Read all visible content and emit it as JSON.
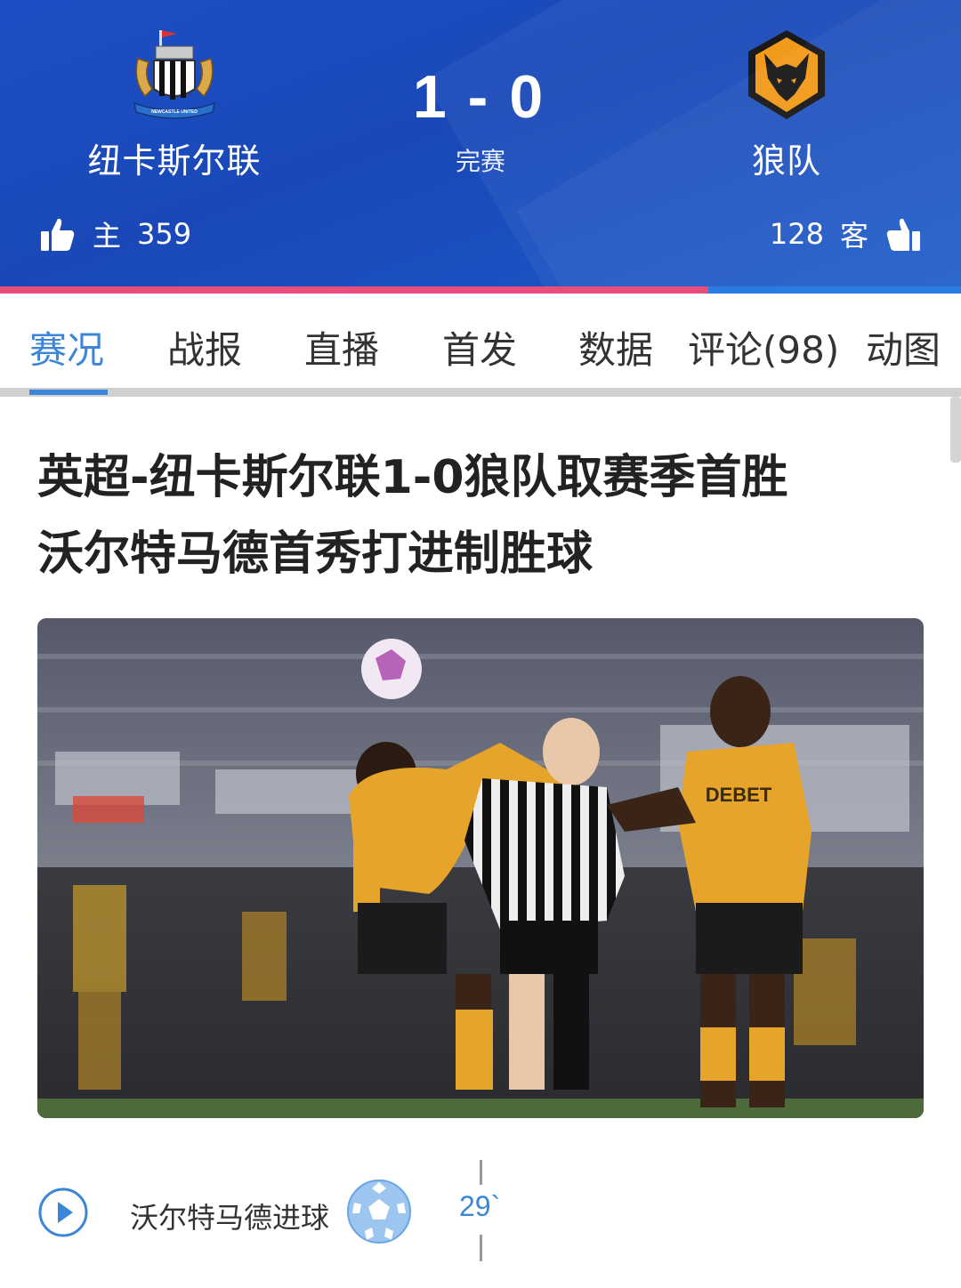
{
  "match": {
    "home": {
      "name": "纽卡斯尔联",
      "likes_label": "主",
      "likes": "359",
      "crest_text": "NEWCASTLE UNITED"
    },
    "away": {
      "name": "狼队",
      "likes_label": "客",
      "likes": "128"
    },
    "score_home": "1",
    "score_away": "0",
    "score_separator": "-",
    "status": "完赛",
    "home_like_share": 0.737
  },
  "tabs": [
    {
      "label": "赛况",
      "active": true
    },
    {
      "label": "战报",
      "active": false
    },
    {
      "label": "直播",
      "active": false
    },
    {
      "label": "首发",
      "active": false
    },
    {
      "label": "数据",
      "active": false
    },
    {
      "label": "评论(98)",
      "active": false
    },
    {
      "label": "动图",
      "active": false
    }
  ],
  "article": {
    "headline_line1": "英超-纽卡斯尔联1-0狼队取赛季首胜",
    "headline_line2": "沃尔特马德首秀打进制胜球",
    "photo_sponsor_text": "DEBET"
  },
  "event": {
    "label": "沃尔特马德进球",
    "minute": "29`",
    "icon": "soccer-ball-icon"
  },
  "colors": {
    "header_blue": "#1d4fc4",
    "accent_blue": "#3b86d8",
    "home_bar": "#e94d7b",
    "away_bar": "#2a7be4",
    "wolves_gold": "#f29a1c"
  }
}
